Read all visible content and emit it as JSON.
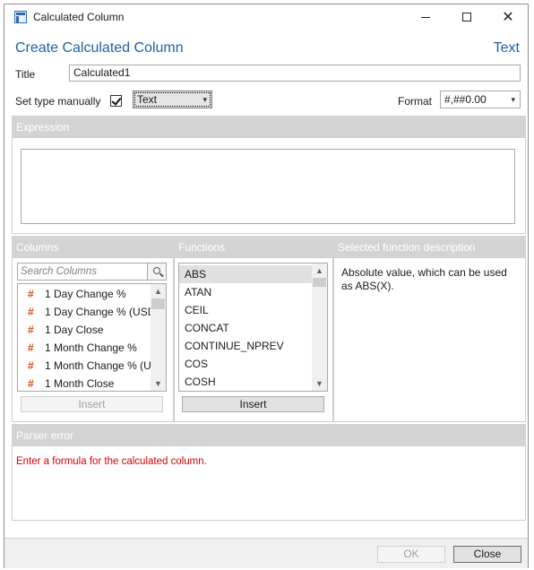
{
  "window": {
    "title": "Calculated Column"
  },
  "header": {
    "title": "Create Calculated Column",
    "type_label": "Text"
  },
  "form": {
    "title_label": "Title",
    "title_value": "Calculated1",
    "set_type_label": "Set type manually",
    "set_type_checked": true,
    "type_value": "Text",
    "format_label": "Format",
    "format_value": "#,##0.00"
  },
  "sections": {
    "expression": "Expression",
    "columns": "Columns",
    "functions": "Functions",
    "description": "Selected function description",
    "parser_error": "Parser error"
  },
  "columns": {
    "search_placeholder": "Search Columns",
    "items": [
      {
        "icon": "hash-icon",
        "label": "1 Day Change %"
      },
      {
        "icon": "hash-icon",
        "label": "1 Day Change % (USD"
      },
      {
        "icon": "hash-icon",
        "label": "1 Day Close"
      },
      {
        "icon": "hash-icon",
        "label": "1 Month Change %"
      },
      {
        "icon": "hash-icon",
        "label": "1 Month Change % (U"
      },
      {
        "icon": "hash-icon",
        "label": "1 Month Close"
      }
    ],
    "insert_label": "Insert"
  },
  "functions": {
    "items": [
      "ABS",
      "ATAN",
      "CEIL",
      "CONCAT",
      "CONTINUE_NPREV",
      "COS",
      "COSH"
    ],
    "selected": "ABS",
    "insert_label": "Insert"
  },
  "description_text": "Absolute value, which can be used as ABS(X).",
  "parser_error_text": "Enter a formula for the calculated column.",
  "footer": {
    "ok_label": "OK",
    "close_label": "Close"
  },
  "colors": {
    "accent": "#1f5fa6",
    "error": "#d40000",
    "section_bg": "#d4d4d4",
    "hash": "#d14a1a"
  }
}
